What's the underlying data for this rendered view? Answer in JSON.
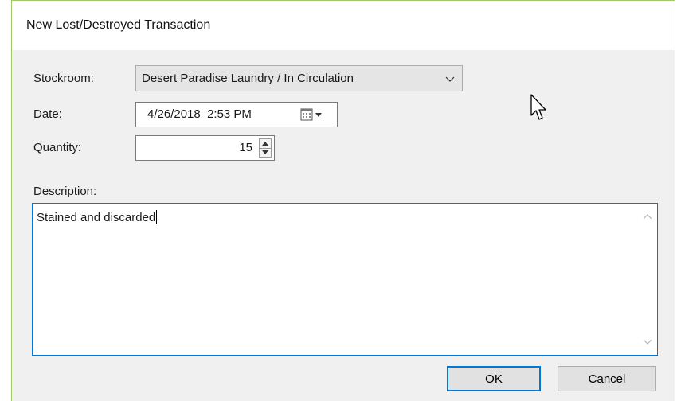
{
  "window": {
    "title": "New Lost/Destroyed Transaction"
  },
  "form": {
    "stockroom": {
      "label": "Stockroom:",
      "value": "Desert Paradise Laundry / In Circulation"
    },
    "date": {
      "label": "Date:",
      "value": "4/26/2018  2:53 PM"
    },
    "quantity": {
      "label": "Quantity:",
      "value": "15"
    },
    "description": {
      "label": "Description:",
      "value": "Stained and discarded"
    }
  },
  "buttons": {
    "ok": "OK",
    "cancel": "Cancel"
  },
  "colors": {
    "accent": "#0078d7",
    "window_bg": "#f0f0f0",
    "frame": "#a0c96e"
  }
}
